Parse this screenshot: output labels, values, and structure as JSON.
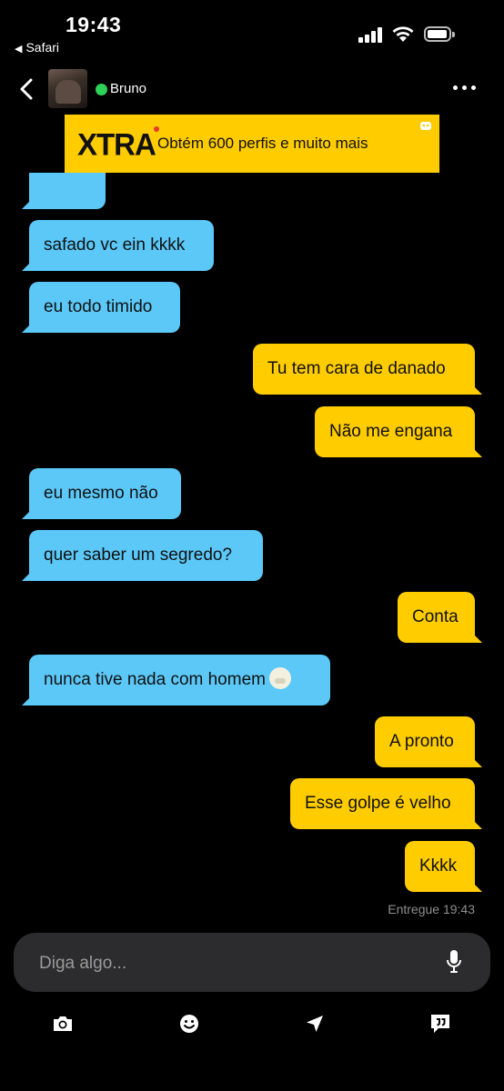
{
  "status_bar": {
    "time": "19:43",
    "back_app": "Safari"
  },
  "header": {
    "username": "Bruno",
    "online": true
  },
  "ad": {
    "logo": "XTRA",
    "text": "Obtém 600 perfis e muito mais"
  },
  "messages": [
    {
      "side": "received",
      "text": "safado vc ein kkkk"
    },
    {
      "side": "received",
      "text": "eu todo timido"
    },
    {
      "side": "sent",
      "text": "Tu tem cara de danado"
    },
    {
      "side": "sent",
      "text": "Não me engana"
    },
    {
      "side": "received",
      "text": "eu mesmo não"
    },
    {
      "side": "received",
      "text": "quer saber um segredo?"
    },
    {
      "side": "sent",
      "text": "Conta"
    },
    {
      "side": "received",
      "text": "nunca tive nada com homem"
    },
    {
      "side": "sent",
      "text": "A pronto"
    },
    {
      "side": "sent",
      "text": "Esse golpe é velho"
    },
    {
      "side": "sent",
      "text": "Kkkk"
    }
  ],
  "delivery_status": "Entregue 19:43",
  "composer": {
    "placeholder": "Diga algo..."
  },
  "toolbar": {
    "icons": [
      "camera-icon",
      "emoji-icon",
      "location-arrow-icon",
      "saved-phrases-icon"
    ]
  },
  "colors": {
    "received_bubble": "#5bc8f8",
    "sent_bubble": "#ffcc00",
    "background": "#000000",
    "online": "#2ed158"
  }
}
